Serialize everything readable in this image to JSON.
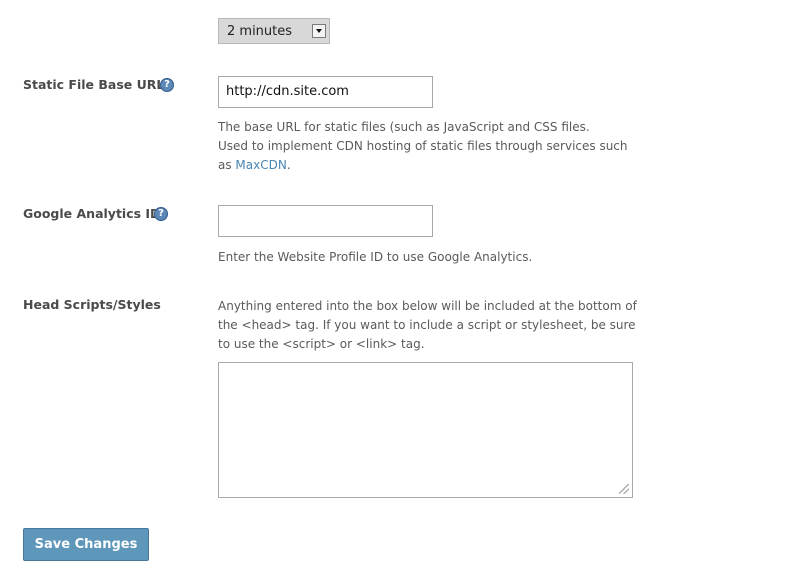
{
  "cache": {
    "selected": "2 minutes"
  },
  "static_url": {
    "label": "Static File Base URL",
    "value": "http://cdn.site.com",
    "desc_line1": "The base URL for static files (such as JavaScript and CSS files.",
    "desc_line2": "Used to implement CDN hosting of static files through services such",
    "desc_prefix": "as ",
    "desc_link": "MaxCDN",
    "desc_suffix": "."
  },
  "analytics": {
    "label": "Google Analytics ID",
    "value": "",
    "desc": "Enter the Website Profile ID to use Google Analytics."
  },
  "head_scripts": {
    "label": "Head Scripts/Styles",
    "desc_line1": "Anything entered into the box below will be included at the bottom of",
    "desc_line2": "the <head> tag. If you want to include a script or stylesheet, be sure",
    "desc_line3": "to use the <script> or <link> tag.",
    "value": ""
  },
  "actions": {
    "save_label": "Save Changes"
  },
  "icons": {
    "help": "help-icon",
    "dropdown": "chevron-down-icon",
    "grip": "resize-grip-icon"
  }
}
